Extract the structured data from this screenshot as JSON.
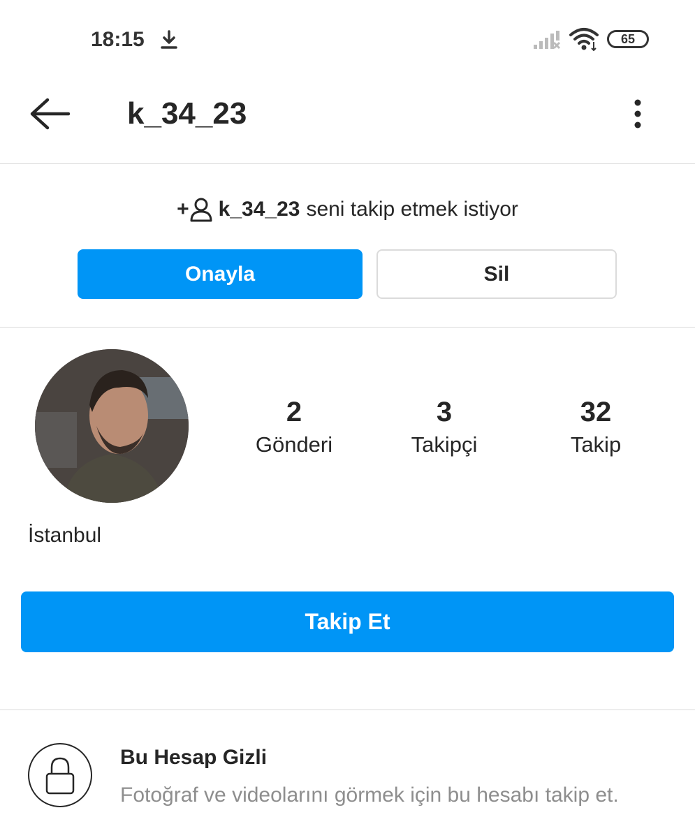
{
  "status_bar": {
    "time": "18:15",
    "battery": "65"
  },
  "header": {
    "title": "k_34_23"
  },
  "follow_request": {
    "username": "k_34_23",
    "message": "seni takip etmek istiyor",
    "confirm_label": "Onayla",
    "delete_label": "Sil"
  },
  "profile": {
    "stats": [
      {
        "value": "2",
        "label": "Gönderi"
      },
      {
        "value": "3",
        "label": "Takipçi"
      },
      {
        "value": "32",
        "label": "Takip"
      }
    ],
    "bio": "İstanbul",
    "follow_button": "Takip Et"
  },
  "private_notice": {
    "title": "Bu Hesap Gizli",
    "description": "Fotoğraf ve videolarını görmek için bu hesabı takip et."
  },
  "colors": {
    "accent": "#0095f6",
    "text": "#262626",
    "muted": "#8e8e8e",
    "divider": "#dbdbdb"
  },
  "icons": [
    "download-icon",
    "signal-icon",
    "wifi-icon",
    "back-arrow-icon",
    "more-options-icon",
    "add-user-icon",
    "lock-icon"
  ]
}
